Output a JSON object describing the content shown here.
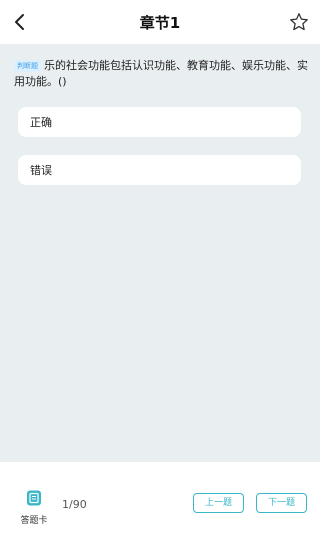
{
  "header": {
    "title": "章节1",
    "back_icon": "chevron-left-icon",
    "favorite_icon": "star-outline-icon"
  },
  "question": {
    "type_badge": "判断题",
    "text": "乐的社会功能包括认识功能、教育功能、娱乐功能、实用功能。()"
  },
  "options": [
    {
      "label": "正确"
    },
    {
      "label": "错误"
    }
  ],
  "footer": {
    "answer_card_label": "答题卡",
    "answer_card_icon": "answer-card-icon",
    "progress": "1/90",
    "prev_label": "上一题",
    "next_label": "下一题"
  },
  "colors": {
    "accent": "#3ab6c9",
    "content_bg": "#e9eef1",
    "badge_bg": "#dcefff",
    "badge_text": "#3ea0e6"
  }
}
